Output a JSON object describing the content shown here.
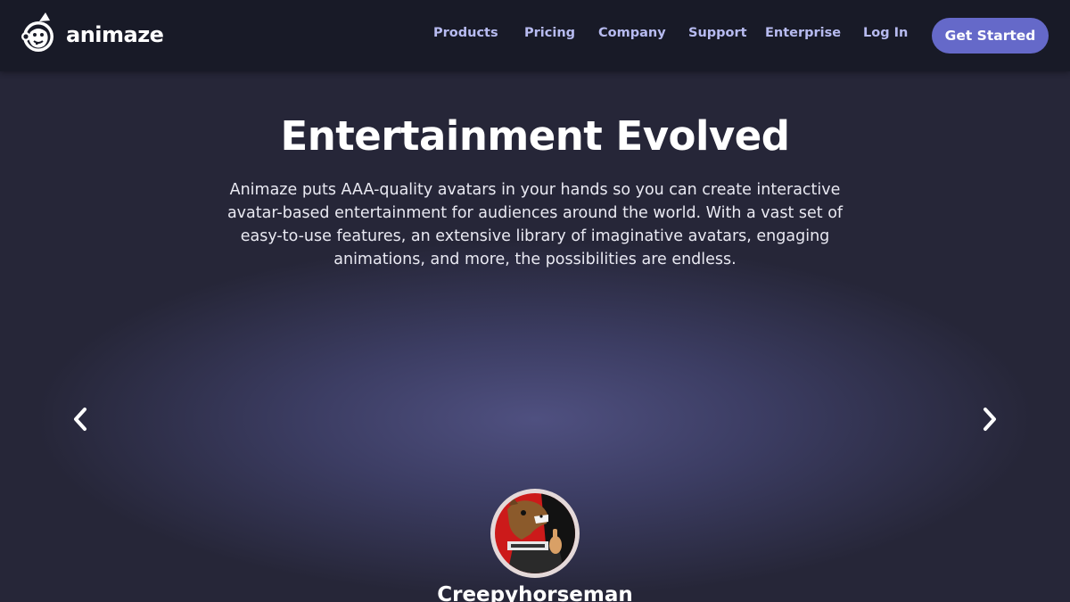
{
  "brand": {
    "name": "animaze",
    "logo_icon": "monkey-face-logo-icon"
  },
  "nav": {
    "items": [
      {
        "label": "Products"
      },
      {
        "label": "Pricing"
      },
      {
        "label": "Company"
      },
      {
        "label": "Support"
      },
      {
        "label": "Enterprise"
      },
      {
        "label": "Log In"
      }
    ],
    "cta_label": "Get Started"
  },
  "hero": {
    "title": "Entertainment Evolved",
    "description": "Animaze puts AAA-quality avatars in your hands so you can create interactive avatar-based entertainment for audiences around the world. With a vast set of easy-to-use features, an extensive library of imaginative avatars, engaging animations, and more, the possibilities are endless."
  },
  "carousel": {
    "prev_icon": "chevron-left-icon",
    "next_icon": "chevron-right-icon",
    "featured": {
      "name": "Creepyhorseman",
      "avatar_icon": "horse-avatar-image"
    }
  },
  "colors": {
    "nav_background": "#181a27",
    "nav_link": "#b7bbf0",
    "accent": "#6569c9",
    "page_background": "#262638"
  }
}
